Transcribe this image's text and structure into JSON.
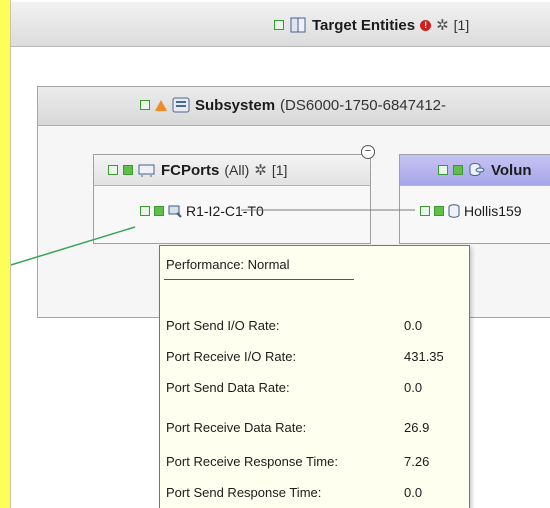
{
  "target": {
    "title": "Target Entities",
    "count": "[1]"
  },
  "subsystem": {
    "title": "Subsystem",
    "id": "(DS6000-1750-6847412-"
  },
  "fcports": {
    "title": "FCPorts",
    "filter": "(All)",
    "count": "[1]",
    "collapse": "−",
    "port_label": "R1-I2-C1-T0"
  },
  "volumes": {
    "title": "Volun",
    "item_label": "Hollis159"
  },
  "tooltip": {
    "status": "Performance: Normal",
    "metrics": [
      {
        "label": "Port Send I/O Rate:",
        "value": "0.0"
      },
      {
        "label": "Port Receive I/O Rate:",
        "value": "431.35"
      },
      {
        "label": "Port Send Data Rate:",
        "value": "0.0"
      },
      {
        "label": "Port Receive Data Rate:",
        "value": "26.9"
      },
      {
        "label": "Port Receive Response Time:",
        "value": "7.26"
      },
      {
        "label": "Port Send Response Time:",
        "value": "0.0"
      }
    ]
  },
  "icons": {
    "status_normal": "green-square-icon",
    "warning": "warning-triangle-icon",
    "error": "error-icon",
    "asterisk": "asterisk-icon",
    "entity": "entity-group-icon",
    "subsystem": "storage-subsystem-icon",
    "fcports": "fc-port-group-icon",
    "volumes": "volume-group-icon",
    "port": "fc-port-icon",
    "volume": "volume-icon"
  },
  "colors": {
    "background": "#fefe5a",
    "link": "#3aa35a",
    "volume_header": "#b3b0ee",
    "status_ok": "#5fbf4a",
    "warning": "#f08a24",
    "error": "#d21e1e"
  }
}
